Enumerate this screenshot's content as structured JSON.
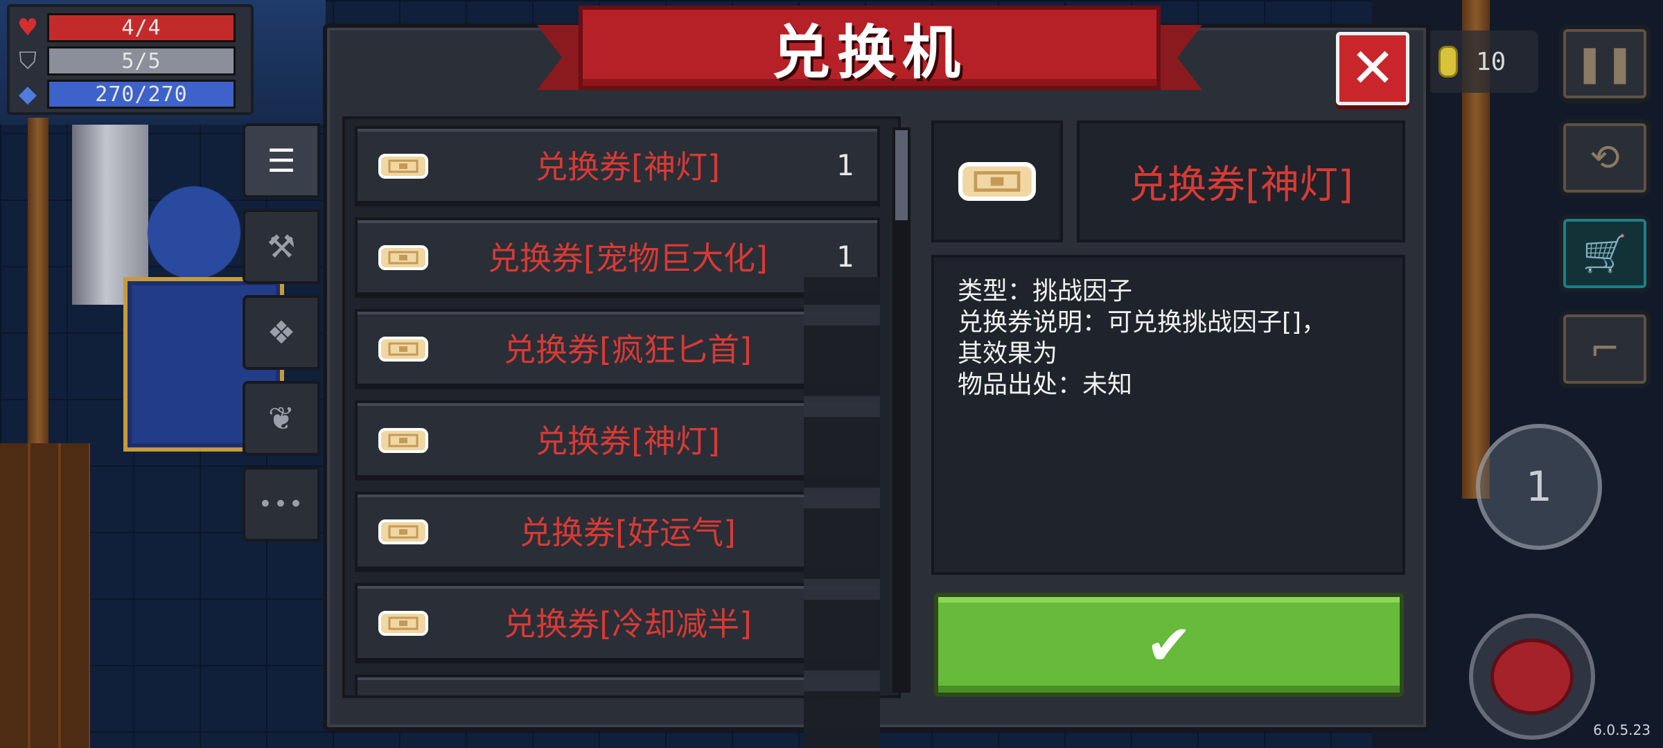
{
  "hud": {
    "hp": "4/4",
    "armor": "5/5",
    "energy": "270/270"
  },
  "coins": "10",
  "version": "6.0.5.23",
  "skill_charges": "1",
  "panel": {
    "title": "兑换机",
    "close_icon": "close-icon",
    "tabs": [
      {
        "name": "list-icon",
        "glyph": "☰"
      },
      {
        "name": "weapon-icon",
        "glyph": "⚒"
      },
      {
        "name": "relic-icon",
        "glyph": "❖"
      },
      {
        "name": "plant-icon",
        "glyph": "❦"
      },
      {
        "name": "more-icon",
        "glyph": "•••"
      }
    ]
  },
  "items": [
    {
      "label": "兑换券[神灯]",
      "count": "1"
    },
    {
      "label": "兑换券[宠物巨大化]",
      "count": "1"
    },
    {
      "label": "兑换券[疯狂匕首]",
      "count": ""
    },
    {
      "label": "兑换券[神灯]",
      "count": ""
    },
    {
      "label": "兑换券[好运气]",
      "count": ""
    },
    {
      "label": "兑换券[冷却减半]",
      "count": ""
    }
  ],
  "detail": {
    "name": "兑换券[神灯]",
    "type_line": "类型：挑战因子",
    "desc_line1": "兑换券说明：可兑换挑战因子[]，",
    "desc_line2": "其效果为",
    "source_line": "物品出处：未知"
  },
  "confirm_icon": "checkmark-icon",
  "colors": {
    "item_text": "#d83a34",
    "banner": "#b62127",
    "confirm": "#66bb3a"
  }
}
